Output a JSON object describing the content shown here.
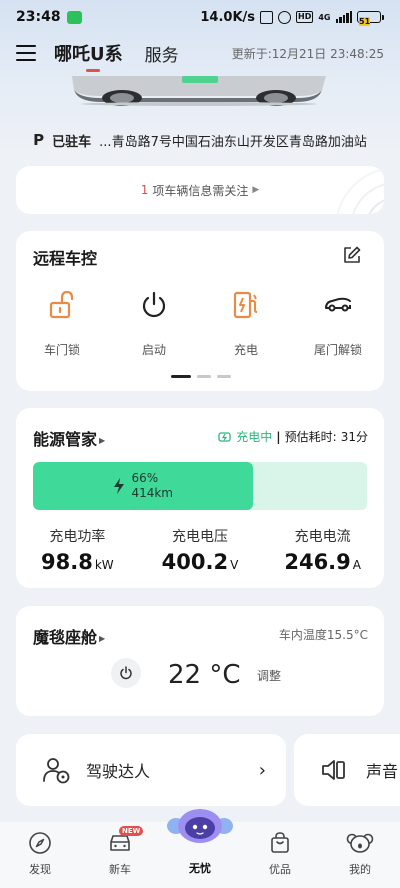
{
  "status_bar": {
    "time": "23:48",
    "speed": "14.0K/s",
    "network": "4G",
    "battery": "51"
  },
  "header": {
    "tab_active": "哪吒U系",
    "tab_service": "服务",
    "update_time": "更新于:12月21日 23:48:25"
  },
  "location": {
    "p": "P",
    "status": "已驻车",
    "address": "...青岛路7号中国石油东山开发区青岛路加油站"
  },
  "notice": {
    "count": "1",
    "text": "项车辆信息需关注"
  },
  "remote_control": {
    "title": "远程车控",
    "items": [
      {
        "label": "车门锁",
        "icon": "unlock-icon"
      },
      {
        "label": "启动",
        "icon": "power-icon"
      },
      {
        "label": "充电",
        "icon": "charge-station-icon"
      },
      {
        "label": "尾门解锁",
        "icon": "trunk-icon"
      }
    ]
  },
  "energy": {
    "title": "能源管家",
    "status": "充电中",
    "estimate_label": "预估耗时:",
    "estimate_value": "31分",
    "battery_percent": "66%",
    "battery_fraction": 0.66,
    "range": "414km",
    "stats": [
      {
        "label": "充电功率",
        "value": "98.8",
        "unit": "kW"
      },
      {
        "label": "充电电压",
        "value": "400.2",
        "unit": "V"
      },
      {
        "label": "充电电流",
        "value": "246.9",
        "unit": "A"
      }
    ]
  },
  "cabin": {
    "title": "魔毯座舱",
    "inner_temp": "车内温度15.5°C",
    "set_temp": "22 °C",
    "adjust": "调整"
  },
  "shortcuts": {
    "driver": "驾驶达人",
    "sound": "声音"
  },
  "bottom_nav": {
    "items": [
      {
        "label": "发现"
      },
      {
        "label": "新车",
        "badge": "NEW"
      },
      {
        "label": "无忧"
      },
      {
        "label": "优品"
      },
      {
        "label": "我的"
      }
    ]
  },
  "colors": {
    "accent_red": "#e2504c",
    "charge_green": "#3fd999",
    "icon_orange": "#e98a45"
  }
}
